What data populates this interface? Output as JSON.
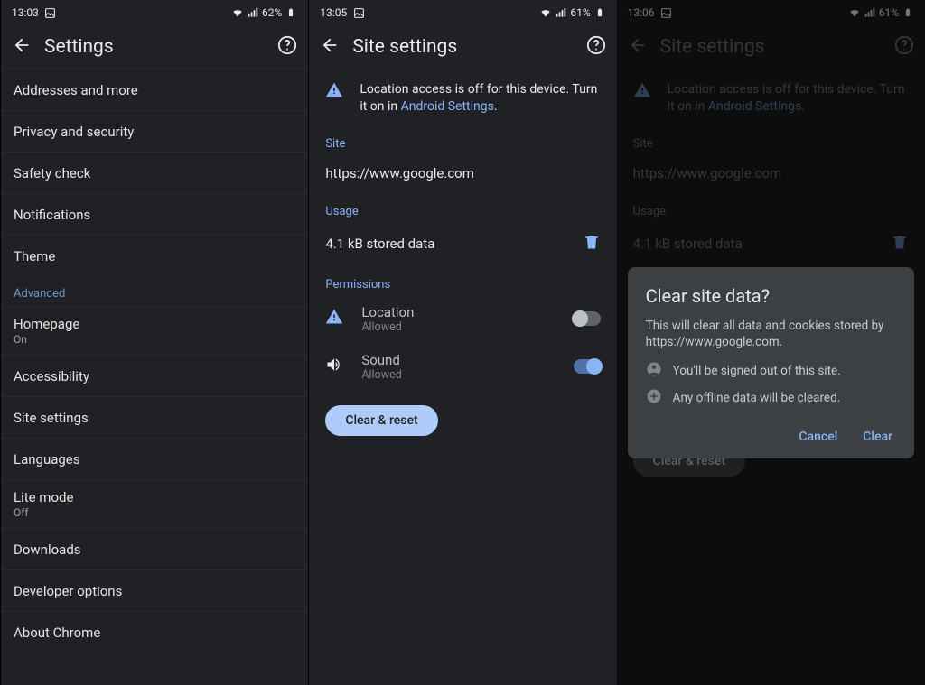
{
  "panel1": {
    "status": {
      "time": "13:03",
      "battery": "62%"
    },
    "title": "Settings",
    "items": [
      {
        "label": "Addresses and more"
      },
      {
        "label": "Privacy and security"
      },
      {
        "label": "Safety check"
      },
      {
        "label": "Notifications"
      },
      {
        "label": "Theme"
      }
    ],
    "advanced_label": "Advanced",
    "advanced_items": [
      {
        "label": "Homepage",
        "sub": "On"
      },
      {
        "label": "Accessibility"
      },
      {
        "label": "Site settings"
      },
      {
        "label": "Languages"
      },
      {
        "label": "Lite mode",
        "sub": "Off"
      },
      {
        "label": "Downloads"
      },
      {
        "label": "Developer options"
      },
      {
        "label": "About Chrome"
      }
    ]
  },
  "panel2": {
    "status": {
      "time": "13:05",
      "battery": "61%"
    },
    "title": "Site settings",
    "warning_prefix": "Location access is off for this device. Turn it on in ",
    "warning_link": "Android Settings",
    "warning_suffix": ".",
    "section_site": "Site",
    "site_url": "https://www.google.com",
    "section_usage": "Usage",
    "usage_text": "4.1 kB stored data",
    "section_permissions": "Permissions",
    "perm_location": {
      "title": "Location",
      "sub": "Allowed"
    },
    "perm_sound": {
      "title": "Sound",
      "sub": "Allowed"
    },
    "clear_reset": "Clear & reset"
  },
  "panel3": {
    "status": {
      "time": "13:06",
      "battery": "61%"
    },
    "title": "Site settings",
    "warning_prefix": "Location access is off for this device. Turn it on in ",
    "warning_link": "Android Settings",
    "warning_suffix": ".",
    "section_site": "Site",
    "site_url": "https://www.google.com",
    "section_usage": "Usage",
    "usage_text": "4.1 kB stored data",
    "clear_reset": "Clear & reset",
    "dialog": {
      "title": "Clear site data?",
      "body": "This will clear all data and cookies stored by https://www.google.com.",
      "bullet1": "You'll be signed out of this site.",
      "bullet2": "Any offline data will be cleared.",
      "cancel": "Cancel",
      "clear": "Clear"
    }
  }
}
